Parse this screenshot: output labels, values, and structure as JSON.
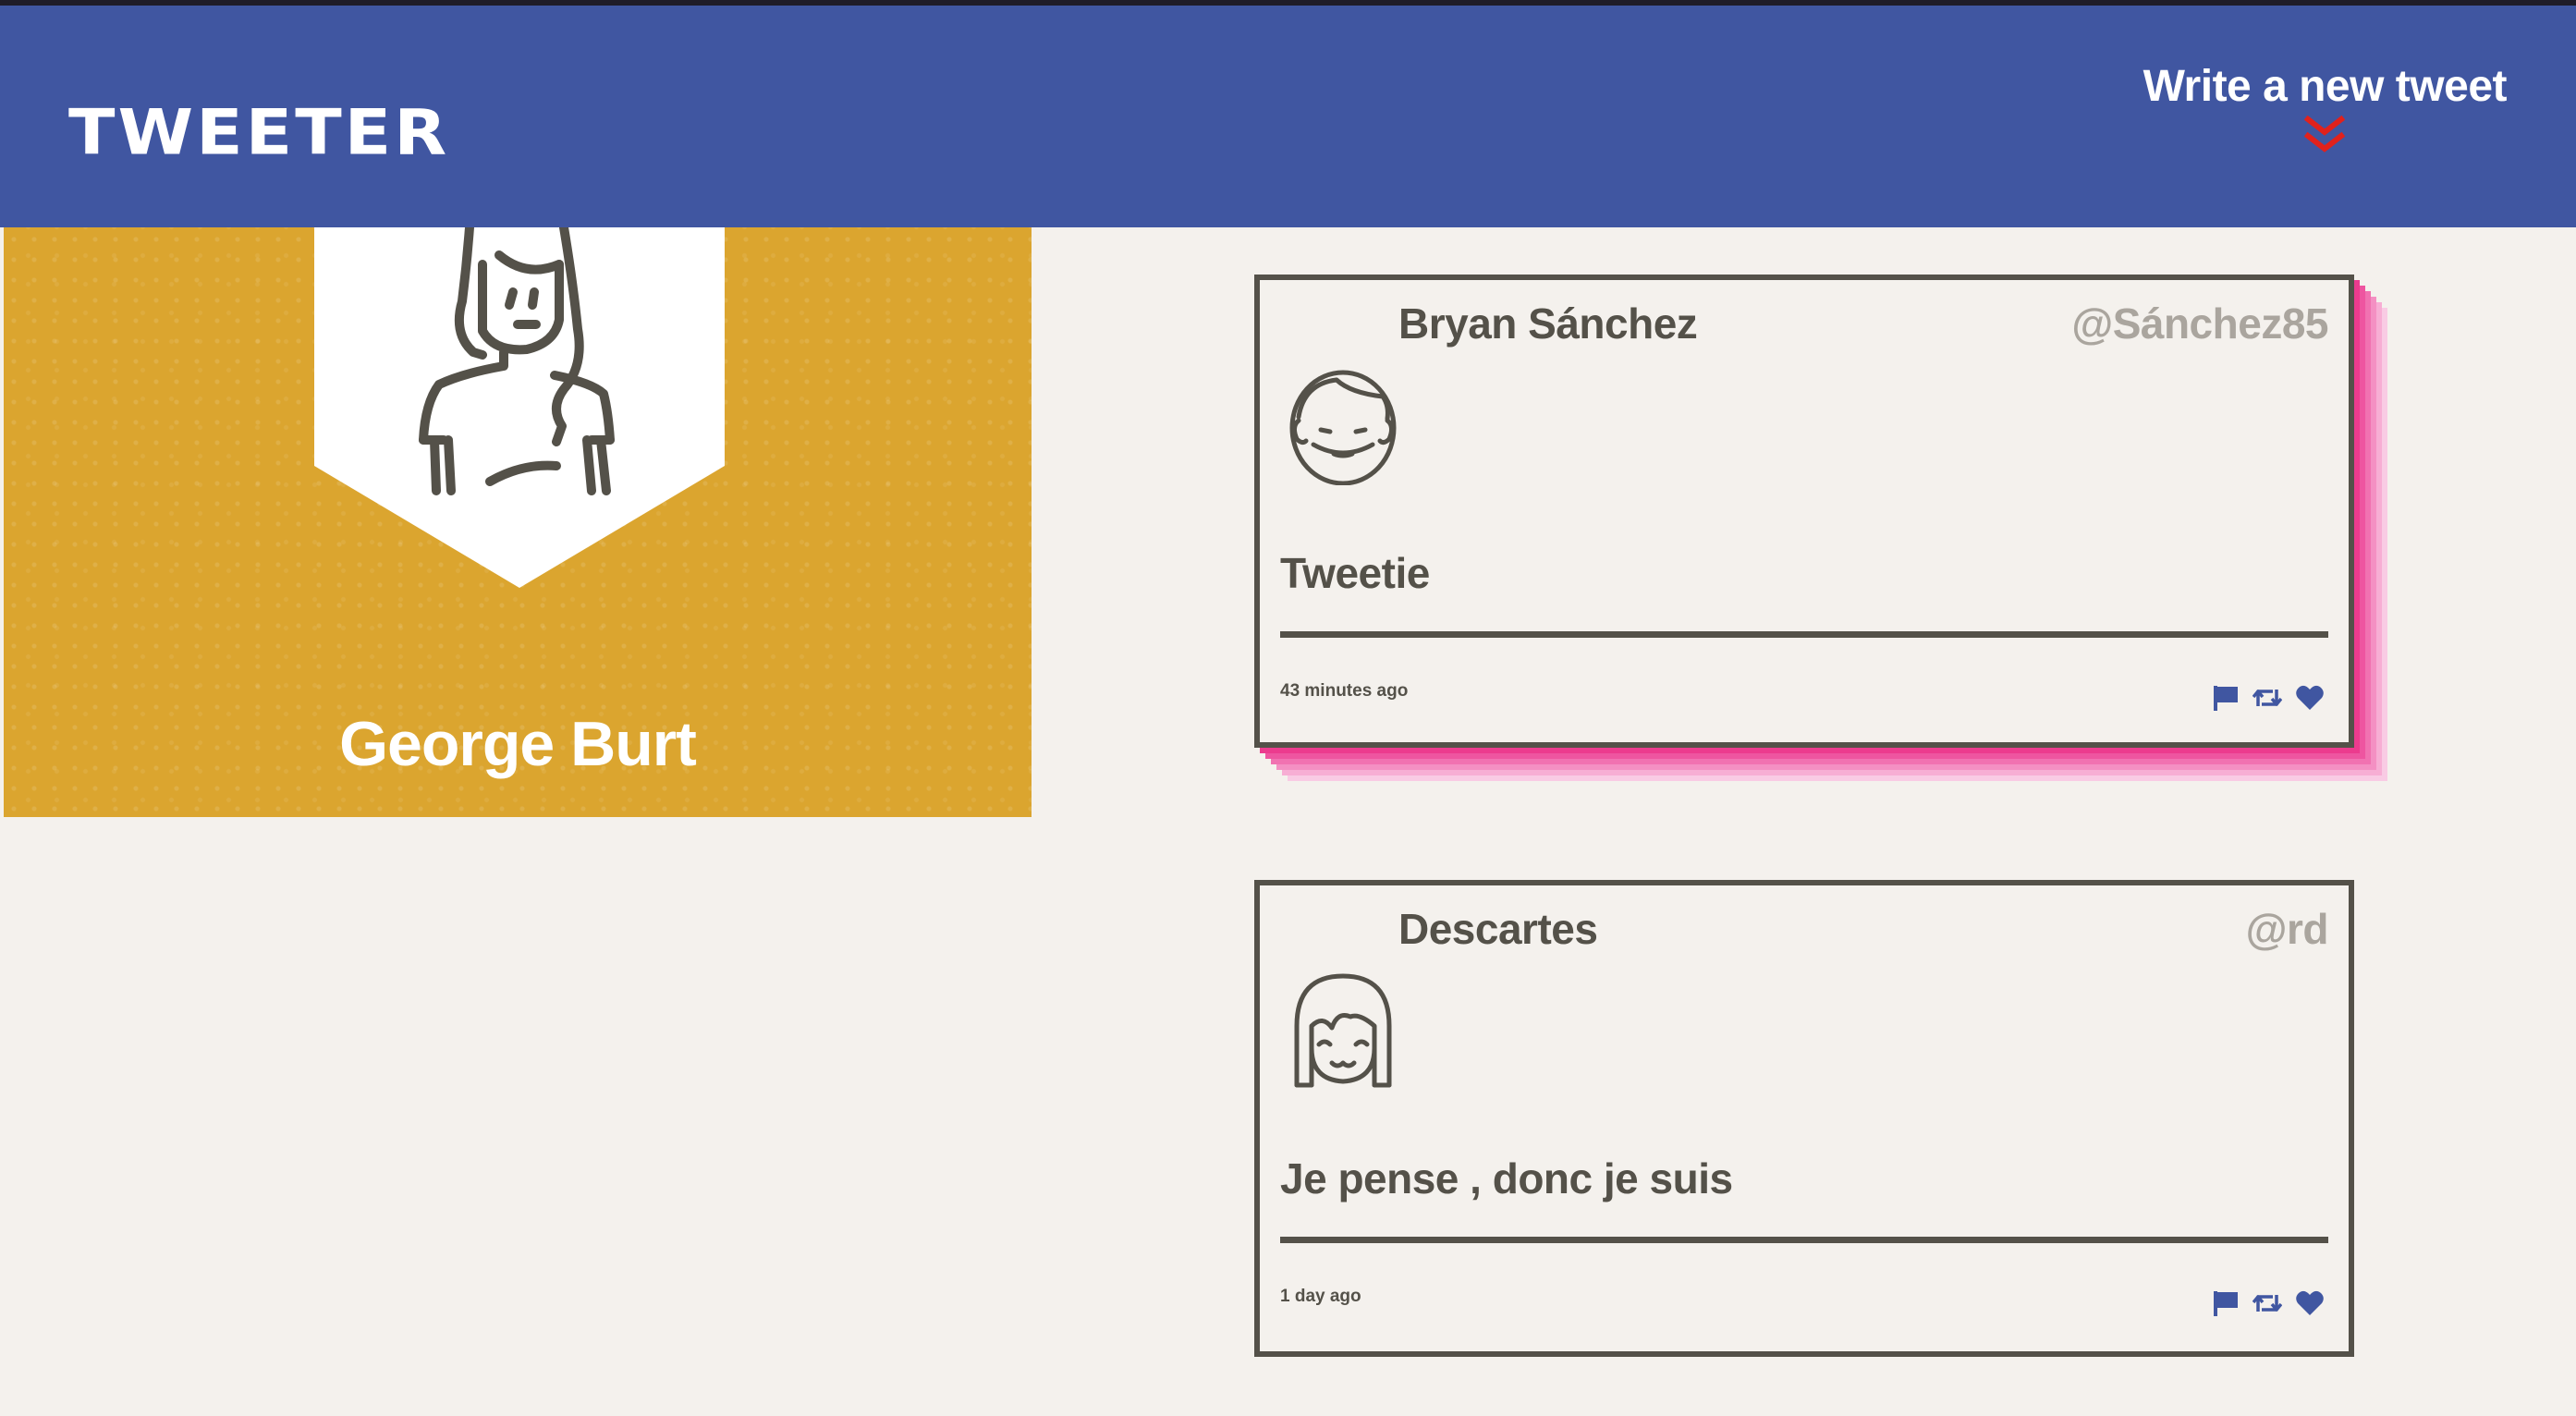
{
  "header": {
    "brand": "TWEETER",
    "compose_label": "Write a new tweet",
    "compose_icon": "double-chevron-down-icon",
    "colors": {
      "background": "#4056a1",
      "accent": "#e1211c"
    }
  },
  "profile": {
    "name": "George Burt",
    "avatar_icon": "woman-avatar-icon",
    "background_color": "#dba52f"
  },
  "tweets": [
    {
      "name": "Bryan Sánchez",
      "handle": "@Sánchez85",
      "avatar_icon": "boy-avatar-icon",
      "text": "Tweetie",
      "time": "43 minutes ago",
      "actions": [
        "flag-icon",
        "retweet-icon",
        "heart-icon"
      ]
    },
    {
      "name": "Descartes",
      "handle": "@rd",
      "avatar_icon": "girl-avatar-icon",
      "text": "Je pense , donc je suis",
      "time": "1 day ago",
      "actions": [
        "flag-icon",
        "retweet-icon",
        "heart-icon"
      ]
    }
  ],
  "colors": {
    "page_background": "#f4f1ed",
    "text": "#545149",
    "handle": "#aaa59e",
    "action_icons": "#4056a1",
    "tweet_shadow": "#ec3b8e"
  }
}
